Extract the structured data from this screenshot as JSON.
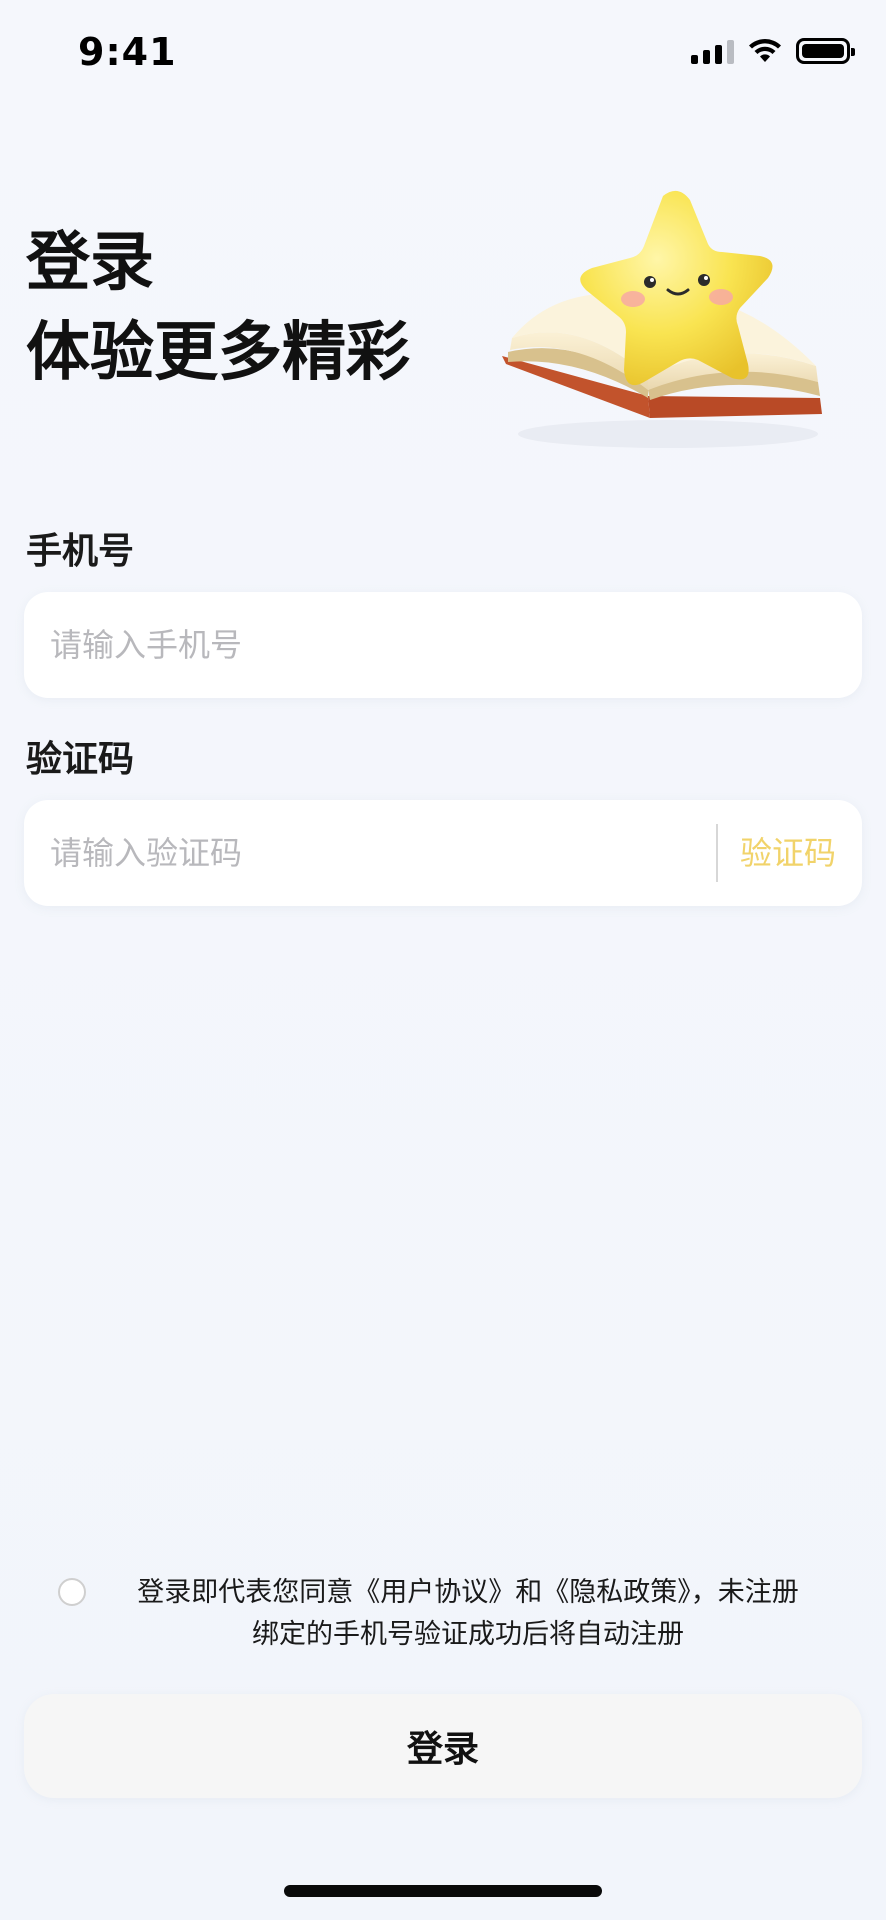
{
  "status_bar": {
    "time": "9:41"
  },
  "header": {
    "title_line1": "登录",
    "title_line2": "体验更多精彩"
  },
  "phone_field": {
    "label": "手机号",
    "placeholder": "请输入手机号",
    "value": ""
  },
  "code_field": {
    "label": "验证码",
    "placeholder": "请输入验证码",
    "value": "",
    "send_button_label": "验证码"
  },
  "agreement": {
    "checked": false,
    "text_line1": "登录即代表您同意《用户协议》和《隐私政策》，未注册",
    "text_line2": "绑定的手机号验证成功后将自动注册"
  },
  "login_button": {
    "label": "登录"
  },
  "colors": {
    "accent": "#f1d36a",
    "background": "#f3f6fb",
    "field_background": "#ffffff"
  },
  "icons": {
    "signal": "cellular-signal-icon",
    "wifi": "wifi-icon",
    "battery": "battery-icon",
    "mascot": "star-on-book-illustration"
  }
}
